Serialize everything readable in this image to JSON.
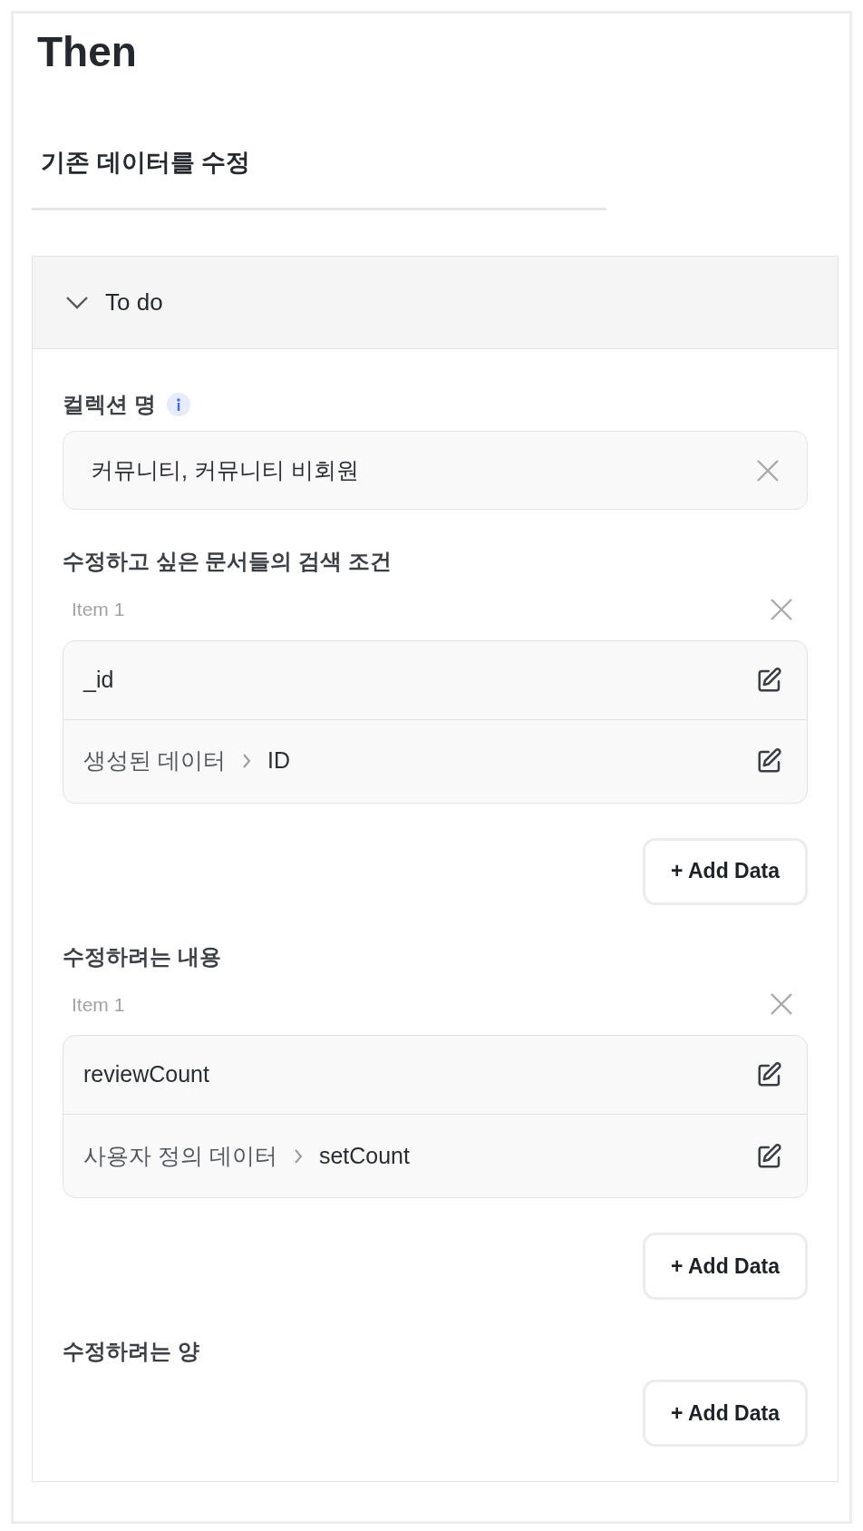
{
  "title": "Then",
  "subtitle": "기존 데이터를 수정",
  "accordion": {
    "label": "To do",
    "expanded": true
  },
  "collection": {
    "label": "컬렉션 명",
    "value": "커뮤니티, 커뮤니티 비회원"
  },
  "sections": [
    {
      "label": "수정하고 싶은 문서들의 검색 조건",
      "items": [
        {
          "label": "Item 1",
          "rows": [
            {
              "segments": [
                "_id"
              ]
            },
            {
              "segments": [
                "생성된 데이터",
                "ID"
              ]
            }
          ]
        }
      ],
      "button": "+ Add Data"
    },
    {
      "label": "수정하려는 내용",
      "items": [
        {
          "label": "Item 1",
          "rows": [
            {
              "segments": [
                "reviewCount"
              ]
            },
            {
              "segments": [
                "사용자 정의 데이터",
                "setCount"
              ]
            }
          ]
        }
      ],
      "button": "+ Add Data"
    },
    {
      "label": "수정하려는 양",
      "button": "+ Add Data"
    }
  ]
}
